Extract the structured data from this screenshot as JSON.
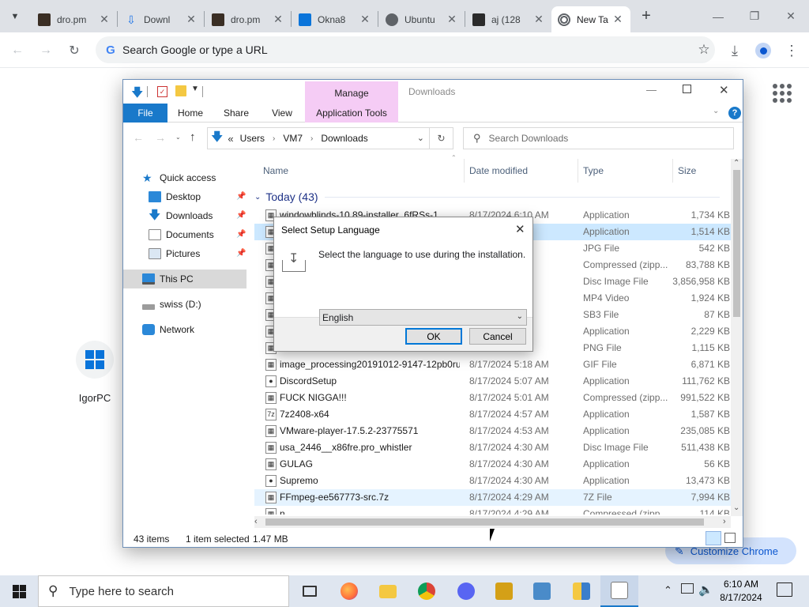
{
  "browser": {
    "tabs": [
      {
        "label": "dro.pm",
        "favicon": "document-icon",
        "active": false
      },
      {
        "label": "Downl",
        "favicon": "download-icon",
        "active": false
      },
      {
        "label": "dro.pm",
        "favicon": "document-icon",
        "active": false
      },
      {
        "label": "Okna8",
        "favicon": "windows-icon",
        "active": false
      },
      {
        "label": "Ubuntu",
        "favicon": "globe-icon",
        "active": false
      },
      {
        "label": "aj (128",
        "favicon": "document-icon",
        "active": false
      },
      {
        "label": "New Ta",
        "favicon": "chrome-icon",
        "active": true
      }
    ],
    "new_tab_glyph": "+",
    "omnibox_placeholder": "Search Google or type a URL",
    "customize_label": "Customize Chrome"
  },
  "ntp": {
    "shortcut_label": "IgorPC"
  },
  "explorer": {
    "window_title": "Downloads",
    "manage_label": "Manage",
    "ribbon_tabs": [
      "File",
      "Home",
      "Share",
      "View",
      "Application Tools"
    ],
    "breadcrumb": [
      "«",
      "Users",
      "VM7",
      "Downloads"
    ],
    "search_placeholder": "Search Downloads",
    "nav": {
      "quick_access": "Quick access",
      "desktop": "Desktop",
      "downloads": "Downloads",
      "documents": "Documents",
      "pictures": "Pictures",
      "this_pc": "This PC",
      "swiss": "swiss (D:)",
      "network": "Network"
    },
    "columns": {
      "name": "Name",
      "date": "Date modified",
      "type": "Type",
      "size": "Size"
    },
    "group_label": "Today (43)",
    "files": [
      {
        "name": "windowblinds-10.89-installer_6fRSs-1",
        "date": "8/17/2024 6:10 AM",
        "type": "Application",
        "size": "1,734 KB"
      },
      {
        "name": "",
        "date": "AM",
        "type": "Application",
        "size": "1,514 KB"
      },
      {
        "name": "",
        "date": "AM",
        "type": "JPG File",
        "size": "542 KB"
      },
      {
        "name": "",
        "date": "AM",
        "type": "Compressed (zipp...",
        "size": "83,788 KB"
      },
      {
        "name": "",
        "date": "AM",
        "type": "Disc Image File",
        "size": "3,856,958 KB"
      },
      {
        "name": "",
        "date": "AM",
        "type": "MP4 Video",
        "size": "1,924 KB"
      },
      {
        "name": "",
        "date": "AM",
        "type": "SB3 File",
        "size": "87 KB"
      },
      {
        "name": "",
        "date": "AM",
        "type": "Application",
        "size": "2,229 KB"
      },
      {
        "name": "",
        "date": "AM",
        "type": "PNG File",
        "size": "1,115 KB"
      },
      {
        "name": "image_processing20191012-9147-12pb0ru",
        "date": "8/17/2024 5:18 AM",
        "type": "GIF File",
        "size": "6,871 KB"
      },
      {
        "name": "DiscordSetup",
        "date": "8/17/2024 5:07 AM",
        "type": "Application",
        "size": "111,762 KB"
      },
      {
        "name": "FUCK NIGGA!!!",
        "date": "8/17/2024 5:01 AM",
        "type": "Compressed (zipp...",
        "size": "991,522 KB"
      },
      {
        "name": "7z2408-x64",
        "date": "8/17/2024 4:57 AM",
        "type": "Application",
        "size": "1,587 KB"
      },
      {
        "name": "VMware-player-17.5.2-23775571",
        "date": "8/17/2024 4:53 AM",
        "type": "Application",
        "size": "235,085 KB"
      },
      {
        "name": "usa_2446__x86fre.pro_whistler",
        "date": "8/17/2024 4:30 AM",
        "type": "Disc Image File",
        "size": "511,438 KB"
      },
      {
        "name": "GULAG",
        "date": "8/17/2024 4:30 AM",
        "type": "Application",
        "size": "56 KB"
      },
      {
        "name": "Supremo",
        "date": "8/17/2024 4:30 AM",
        "type": "Application",
        "size": "13,473 KB"
      },
      {
        "name": "FFmpeg-ee567773-src.7z",
        "date": "8/17/2024 4:29 AM",
        "type": "7Z File",
        "size": "7,994 KB"
      },
      {
        "name": "n",
        "date": "8/17/2024 4:29 AM",
        "type": "Compressed (zipp...",
        "size": "114 KB"
      }
    ],
    "status": {
      "count": "43 items",
      "selected": "1 item selected",
      "size": "1.47 MB"
    }
  },
  "dialog": {
    "title": "Select Setup Language",
    "message": "Select the language to use during the installation.",
    "selected_language": "English",
    "ok_label": "OK",
    "cancel_label": "Cancel"
  },
  "taskbar": {
    "search_placeholder": "Type here to search",
    "time": "6:10 AM",
    "date": "8/17/2024",
    "apps": [
      "task-view-icon",
      "firefox-icon",
      "file-explorer-icon",
      "chrome-icon",
      "discord-icon",
      "puzzle-app-icon",
      "media-app-icon",
      "archive-app-icon",
      "installer-app-icon"
    ]
  },
  "colors": {
    "accent": "#0078d7",
    "file_tab": "#1979ca",
    "manage": "#f5ccf5",
    "selection": "#cce8ff"
  }
}
